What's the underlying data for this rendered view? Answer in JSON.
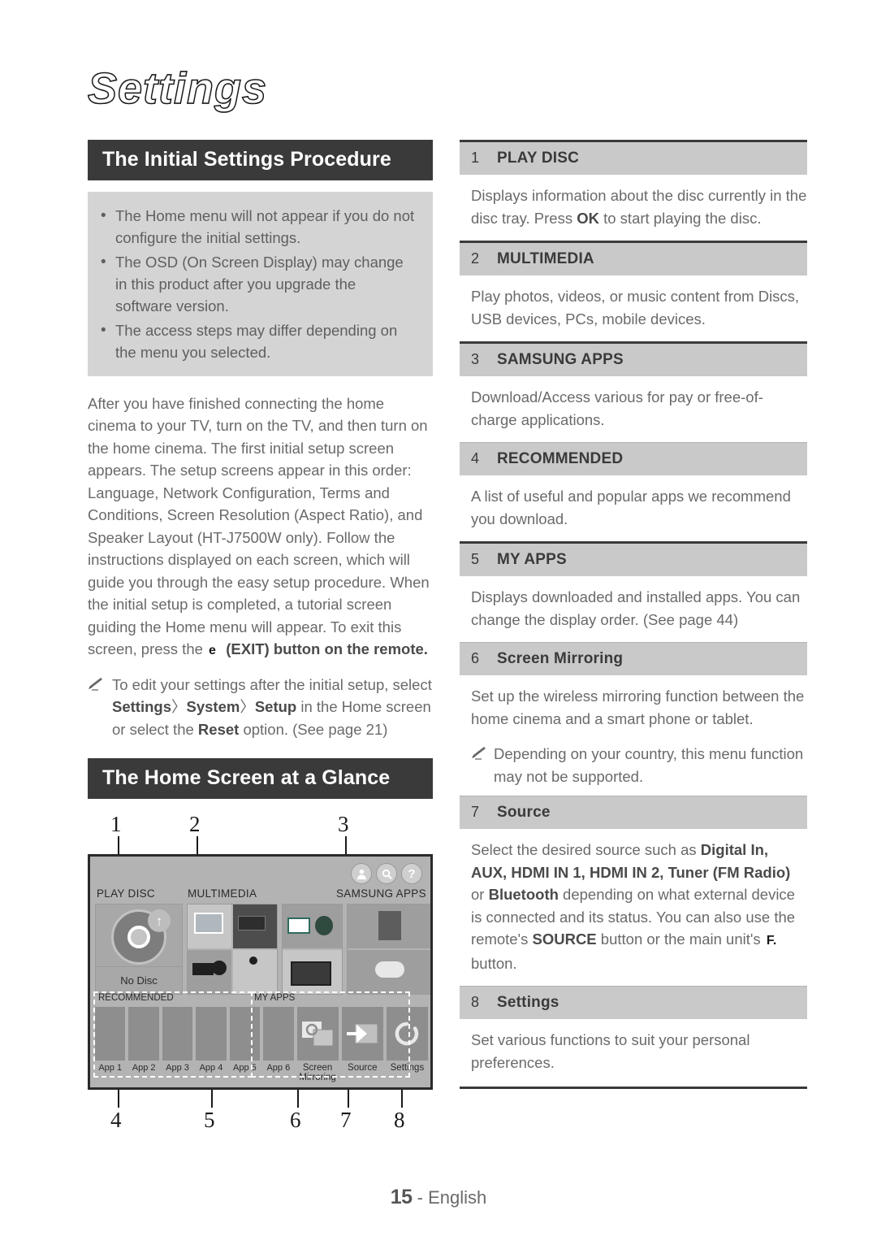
{
  "document": {
    "chapter_title": "Settings",
    "footer": {
      "page_number": "15",
      "separator": "-",
      "language": "English"
    }
  },
  "left_column": {
    "section1_banner": "The Initial Settings Procedure",
    "notebox_bullets": [
      "The Home menu will not appear if you do not configure the initial settings.",
      "The OSD (On Screen Display) may change in this product after you upgrade the software version.",
      "The access steps may differ depending on the menu you selected."
    ],
    "bullet_marker": "•",
    "body_paragraph": {
      "part1": "After you have finished connecting the home cinema to your TV, turn on the TV, and then turn on the home cinema. The first initial setup screen appears. The setup screens appear in this order: Language, Network Configuration, Terms and Conditions, Screen Resolution (Aspect Ratio), and Speaker Layout (HT-J7500W only). Follow the instructions displayed on each screen, which will guide you through the easy setup procedure. When the initial setup is completed, a tutorial screen guiding the Home menu will appear. To exit this screen, press the ",
      "exit_button_glyph": "e",
      "part2": "(EXIT) button on the remote."
    },
    "note": {
      "icon": "pencil-icon",
      "text_before": "To edit your settings after the initial setup, select ",
      "menu_path": [
        "Settings",
        "System",
        "Setup"
      ],
      "path_separator": "〉",
      "text_middle": " in the Home screen or select the ",
      "reset_label": "Reset",
      "text_after": " option. (See page 21)"
    },
    "section2_banner": "The Home Screen at a Glance"
  },
  "diagram": {
    "callouts_top": [
      "1",
      "2",
      "3"
    ],
    "callouts_bottom": [
      "4",
      "5",
      "6",
      "7",
      "8"
    ],
    "top_icons": [
      "user-icon",
      "search-icon",
      "help-icon"
    ],
    "row_labels": [
      "PLAY DISC",
      "MULTIMEDIA",
      "SAMSUNG APPS"
    ],
    "play_disc_status": "No Disc",
    "disc_badge_glyph": "↑",
    "group_labels": [
      "RECOMMENDED",
      "MY APPS"
    ],
    "app_names": [
      "App 1",
      "App 2",
      "App 3",
      "App 4",
      "App 5",
      "App 6"
    ],
    "function_tiles": [
      {
        "label": "Screen Mirroring",
        "icon": "screen-mirroring-icon"
      },
      {
        "label": "Source",
        "icon": "source-arrow-icon"
      },
      {
        "label": "Settings",
        "icon": "settings-spinner-icon"
      }
    ]
  },
  "right_column": {
    "sections": [
      {
        "number": "1",
        "label": "PLAY DISC",
        "body_part1": "Displays information about the disc currently in the disc tray. Press ",
        "body_bold": "OK",
        "body_part2": " to start playing the disc."
      },
      {
        "number": "2",
        "label": "MULTIMEDIA",
        "body_part1": "Play photos, videos, or music content from Discs, USB devices, PCs, mobile devices.",
        "body_bold": "",
        "body_part2": ""
      },
      {
        "number": "3",
        "label": "SAMSUNG APPS",
        "body_part1": "Download/Access various for pay or free-of-charge applications.",
        "body_bold": "",
        "body_part2": ""
      },
      {
        "number": "4",
        "label": "RECOMMENDED",
        "body_part1": "A list of useful and popular apps we recommend you download.",
        "body_bold": "",
        "body_part2": ""
      },
      {
        "number": "5",
        "label": "MY APPS",
        "body_part1": "Displays downloaded and installed apps. You can change the display order. (See page 44)",
        "body_bold": "",
        "body_part2": ""
      },
      {
        "number": "6",
        "label": "Screen Mirroring",
        "body_part1": "Set up the wireless mirroring function between the home cinema and a smart phone or tablet.",
        "body_bold": "",
        "body_part2": "",
        "note": "Depending on your country, this menu function may not be supported."
      },
      {
        "number": "7",
        "label": "Source",
        "source_text": {
          "lead": "Select the desired source such as ",
          "bold_sources": "Digital In, AUX, HDMI IN 1, HDMI IN 2, Tuner (FM Radio)",
          "mid1": " or ",
          "bold_bluetooth": "Bluetooth",
          "mid2": " depending on what external device is connected and its status. You can also use the remote's ",
          "bold_source_btn": "SOURCE",
          "mid3": " button or the main unit's ",
          "unit_btn_glyph": "F.",
          "tail": " button."
        }
      },
      {
        "number": "8",
        "label": "Settings",
        "body_part1": "Set various functions to suit your personal preferences.",
        "body_bold": "",
        "body_part2": ""
      }
    ]
  }
}
